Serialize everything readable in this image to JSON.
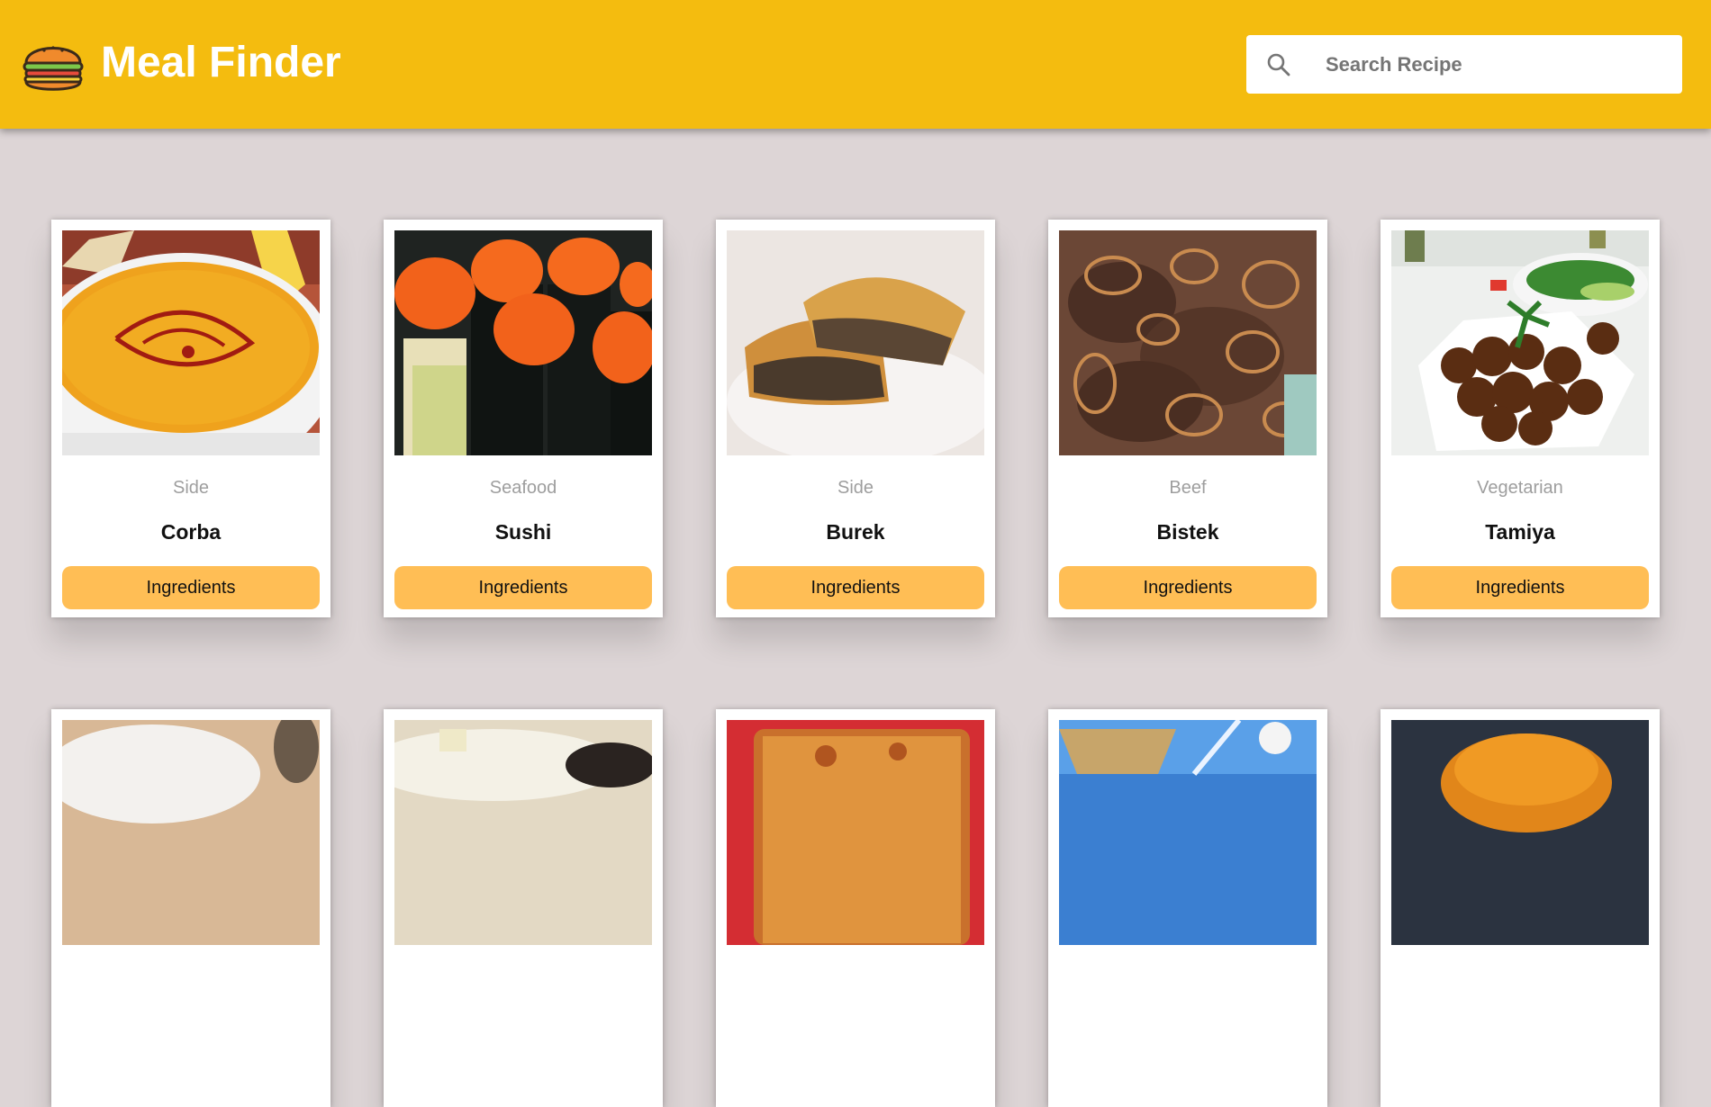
{
  "app": {
    "title": "Meal Finder"
  },
  "search": {
    "placeholder": "Search Recipe",
    "value": ""
  },
  "meals": [
    {
      "category": "Side",
      "name": "Corba",
      "button": "Ingredients",
      "image": "corba-soup-image"
    },
    {
      "category": "Seafood",
      "name": "Sushi",
      "button": "Ingredients",
      "image": "sushi-image"
    },
    {
      "category": "Side",
      "name": "Burek",
      "button": "Ingredients",
      "image": "burek-image"
    },
    {
      "category": "Beef",
      "name": "Bistek",
      "button": "Ingredients",
      "image": "bistek-image"
    },
    {
      "category": "Vegetarian",
      "name": "Tamiya",
      "button": "Ingredients",
      "image": "tamiya-image"
    }
  ],
  "colors": {
    "header": "#f4bc0f",
    "button": "#ffbe55",
    "background": "#ddd5d6",
    "category_text": "#9e9e9e"
  },
  "icons": {
    "logo": "burger-logo-icon",
    "search": "search-icon"
  }
}
